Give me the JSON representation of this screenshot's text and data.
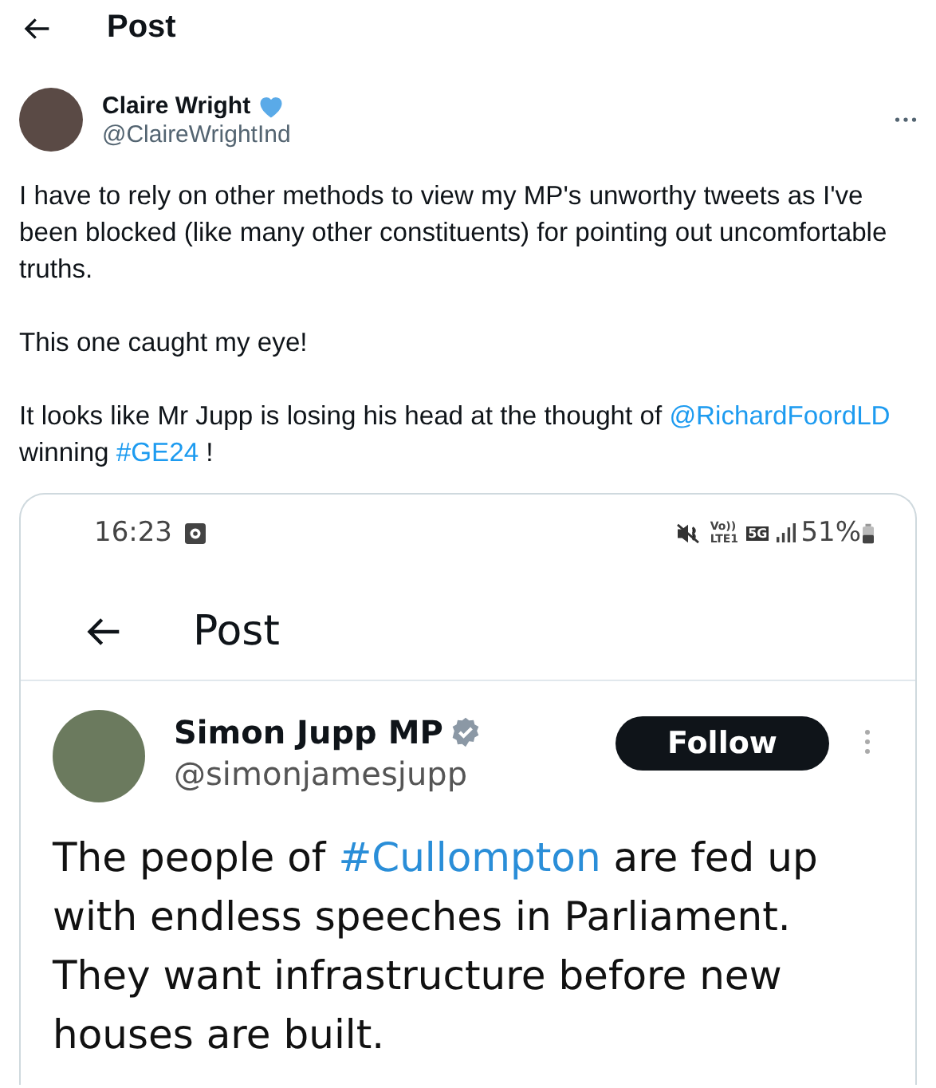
{
  "header": {
    "title": "Post"
  },
  "post": {
    "author": {
      "name": "Claire Wright",
      "handle": "@ClaireWrightInd",
      "heart_badge": true
    },
    "paragraphs": [
      [
        {
          "kind": "plain",
          "text": "I have to rely on other methods to view my MP's unworthy tweets as I've been blocked (like many other constituents) for pointing out uncomfortable truths."
        }
      ],
      [
        {
          "kind": "plain",
          "text": "This one caught my eye!"
        }
      ],
      [
        {
          "kind": "plain",
          "text": "It looks like Mr Jupp is losing his head at the thought of "
        },
        {
          "kind": "mention",
          "text": "@RichardFoordLD"
        },
        {
          "kind": "plain",
          "text": " winning "
        },
        {
          "kind": "hashtag",
          "text": "#GE24"
        },
        {
          "kind": "plain",
          "text": " !"
        }
      ]
    ],
    "screenshot": {
      "status_bar": {
        "time": "16:23",
        "volte": "Vo))",
        "lte": "LTE1",
        "network": "5G",
        "battery": "51%"
      },
      "header": {
        "title": "Post"
      },
      "author": {
        "name": "Simon Jupp MP",
        "handle": "@simonjamesjupp",
        "verified_badge": true
      },
      "follow_button": "Follow",
      "text": [
        {
          "kind": "plain",
          "text": "The people of "
        },
        {
          "kind": "hashtag",
          "text": "#Cullompton"
        },
        {
          "kind": "plain",
          "text": " are fed up with endless speeches in Parliament. They want infrastructure before new houses are built."
        }
      ]
    }
  }
}
